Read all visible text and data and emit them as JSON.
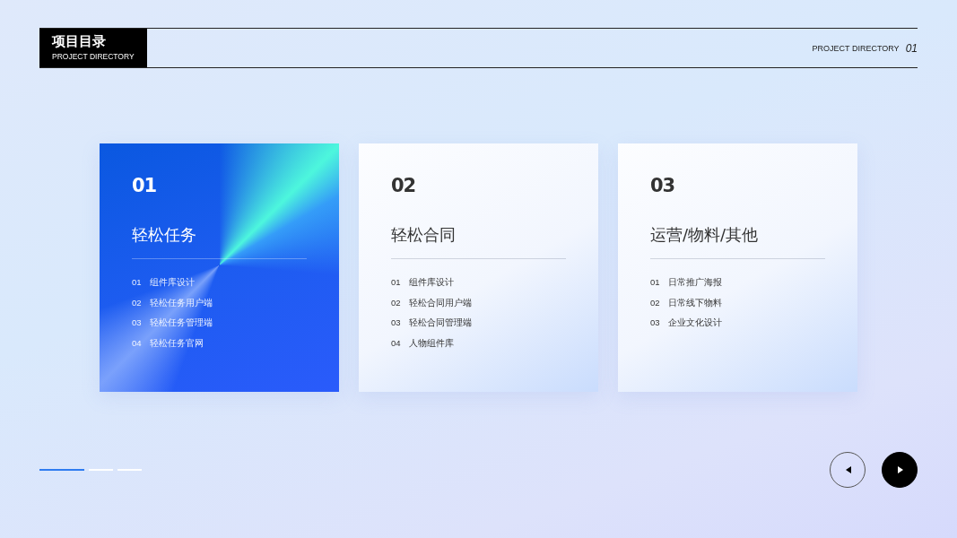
{
  "header": {
    "title": "项目目录",
    "subtitle": "PROJECT DIRECTORY",
    "right_label": "PROJECT DIRECTORY",
    "page_number": "01"
  },
  "cards": [
    {
      "number": "01",
      "title": "轻松任务",
      "selected": true,
      "items": [
        {
          "index": "01",
          "label": "组件库设计"
        },
        {
          "index": "02",
          "label": "轻松任务用户端"
        },
        {
          "index": "03",
          "label": "轻松任务管理端"
        },
        {
          "index": "04",
          "label": "轻松任务官网"
        }
      ]
    },
    {
      "number": "02",
      "title": "轻松合同",
      "selected": false,
      "items": [
        {
          "index": "01",
          "label": "组件库设计"
        },
        {
          "index": "02",
          "label": "轻松合同用户端"
        },
        {
          "index": "03",
          "label": "轻松合同管理端"
        },
        {
          "index": "04",
          "label": "人物组件库"
        }
      ]
    },
    {
      "number": "03",
      "title": "运营/物料/其他",
      "selected": false,
      "items": [
        {
          "index": "01",
          "label": "日常推广海报"
        },
        {
          "index": "02",
          "label": "日常线下物料"
        },
        {
          "index": "03",
          "label": "企业文化设计"
        }
      ]
    }
  ],
  "pager": [
    {
      "selected": true
    },
    {
      "selected": false
    },
    {
      "selected": false
    }
  ],
  "nav_buttons": [
    {
      "kind": "prev",
      "filled": false
    },
    {
      "kind": "next",
      "filled": true
    }
  ]
}
